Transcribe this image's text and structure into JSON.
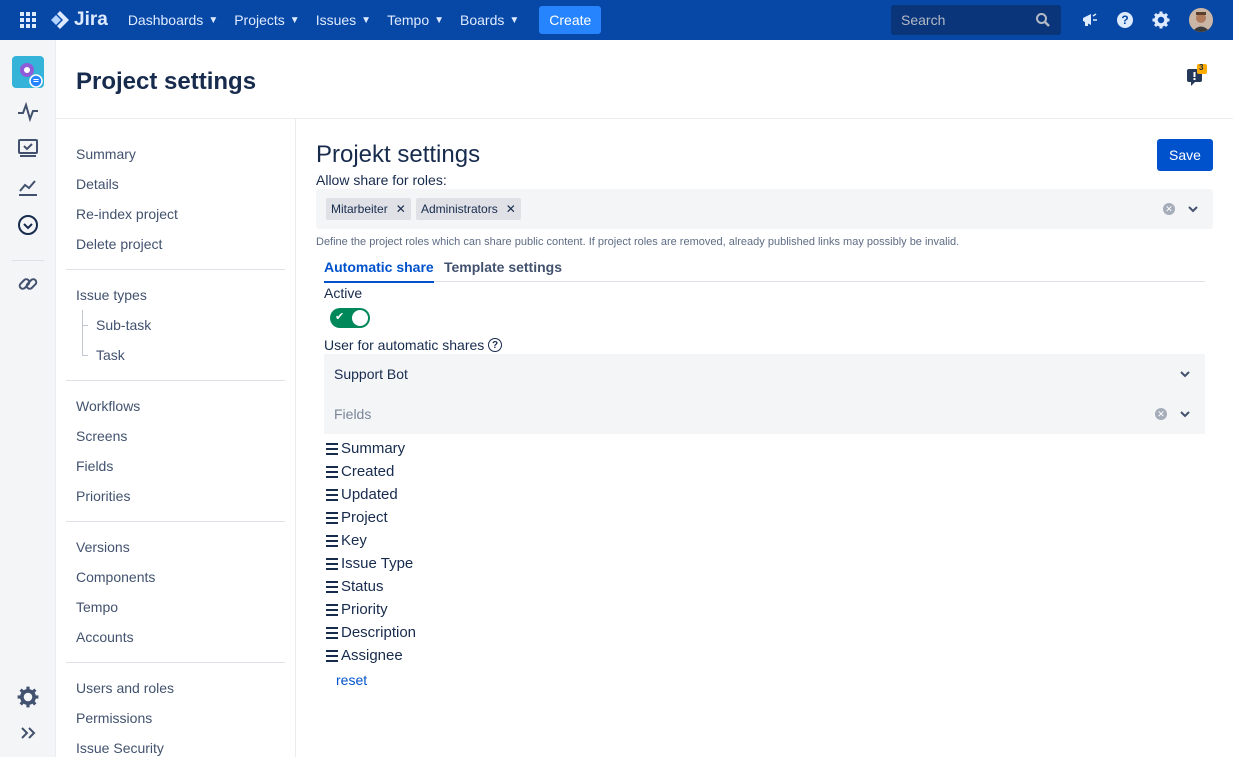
{
  "topnav": {
    "product": "Jira",
    "items": [
      {
        "label": "Dashboards"
      },
      {
        "label": "Projects"
      },
      {
        "label": "Issues"
      },
      {
        "label": "Tempo"
      },
      {
        "label": "Boards"
      }
    ],
    "create_label": "Create",
    "search_placeholder": "Search"
  },
  "notification_badge": "3",
  "page": {
    "title": "Project settings"
  },
  "sidebar": {
    "groups": [
      {
        "items": [
          {
            "label": "Summary"
          },
          {
            "label": "Details"
          },
          {
            "label": "Re-index project"
          },
          {
            "label": "Delete project"
          }
        ]
      },
      {
        "items": [
          {
            "label": "Issue types"
          },
          {
            "label": "Sub-task"
          },
          {
            "label": "Task"
          }
        ]
      },
      {
        "items": [
          {
            "label": "Workflows"
          },
          {
            "label": "Screens"
          },
          {
            "label": "Fields"
          },
          {
            "label": "Priorities"
          }
        ]
      },
      {
        "items": [
          {
            "label": "Versions"
          },
          {
            "label": "Components"
          },
          {
            "label": "Tempo"
          },
          {
            "label": "Accounts"
          }
        ]
      },
      {
        "items": [
          {
            "label": "Users and roles"
          },
          {
            "label": "Permissions"
          },
          {
            "label": "Issue Security"
          }
        ]
      }
    ]
  },
  "main": {
    "heading": "Projekt settings",
    "save_label": "Save",
    "roles_label": "Allow share for roles:",
    "roles": [
      "Mitarbeiter",
      "Administrators"
    ],
    "roles_help": "Define the project roles which can share public content. If project roles are removed, already published links may possibly be invalid.",
    "tabs": [
      "Automatic share",
      "Template settings"
    ],
    "active_label": "Active",
    "active_value": true,
    "user_label": "User for automatic shares",
    "user_value": "Support Bot",
    "fields_placeholder": "Fields",
    "fields": [
      "Summary",
      "Created",
      "Updated",
      "Project",
      "Key",
      "Issue Type",
      "Status",
      "Priority",
      "Description",
      "Assignee"
    ],
    "reset_label": "reset"
  },
  "colors": {
    "nav_bg": "#0747a6",
    "primary": "#0052cc",
    "toggle_on": "#00875a"
  }
}
